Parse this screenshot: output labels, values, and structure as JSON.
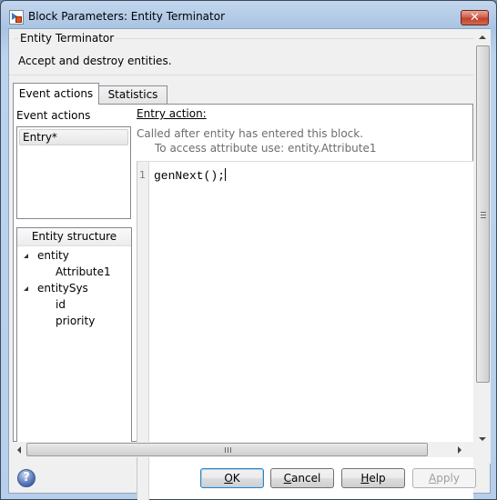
{
  "window": {
    "title": "Block Parameters: Entity Terminator",
    "close_glyph": "✕"
  },
  "block": {
    "name": "Entity Terminator",
    "description": "Accept and destroy entities."
  },
  "tabs": [
    {
      "label": "Event actions",
      "active": true
    },
    {
      "label": "Statistics",
      "active": false
    }
  ],
  "event_actions": {
    "label": "Event actions",
    "items": [
      {
        "label": "Entry*",
        "selected": true
      }
    ]
  },
  "entity_structure": {
    "header": "Entity structure",
    "nodes": [
      {
        "label": "entity",
        "expanded": true,
        "children": [
          "Attribute1"
        ]
      },
      {
        "label": "entitySys",
        "expanded": true,
        "children": [
          "id",
          "priority"
        ]
      }
    ]
  },
  "editor": {
    "section_label": "Entry action:",
    "hint_line1": "Called after entity has entered this block.",
    "hint_line2": "To access attribute use: entity.Attribute1",
    "lines": [
      {
        "number": "1",
        "code": "genNext();"
      }
    ]
  },
  "scrollbars": {
    "horizontal_grip": "III",
    "vertical_grip": "≡"
  },
  "buttons": {
    "help_icon": "?",
    "ok": {
      "mnemonic": "O",
      "rest": "K"
    },
    "cancel": {
      "mnemonic": "C",
      "rest": "ancel"
    },
    "help": {
      "mnemonic": "H",
      "rest": "elp"
    },
    "apply": {
      "mnemonic": "A",
      "rest": "pply",
      "disabled": true
    }
  }
}
